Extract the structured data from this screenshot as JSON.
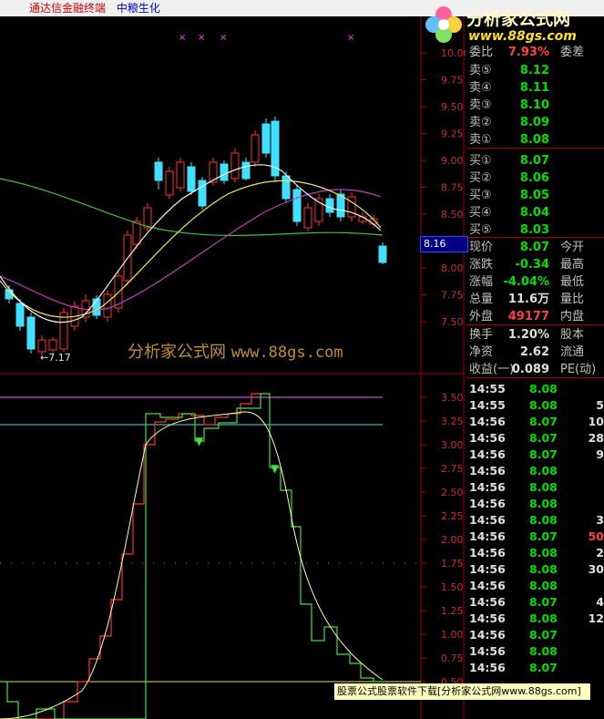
{
  "topbar": {
    "app_title": "通达信金融终端",
    "stock_name": "中粮生化"
  },
  "logo": {
    "name": "分析家公式网",
    "url": "www.88gs.com"
  },
  "watermark": {
    "text": "分析家公式网",
    "url": "www.88gs.com"
  },
  "main_chart": {
    "y_ticks": [
      "10.00",
      "9.75",
      "9.50",
      "9.25",
      "9.00",
      "8.75",
      "8.50",
      "8.25",
      "8.00",
      "7.75",
      "7.50"
    ],
    "low_marker": "7.17",
    "current_price_tag": "8.16"
  },
  "sub_chart": {
    "y_ticks": [
      "3.50",
      "3.25",
      "3.00",
      "2.75",
      "2.50",
      "2.25",
      "2.00",
      "1.75",
      "1.50",
      "1.25",
      "1.00",
      "0.75",
      "0.50"
    ]
  },
  "order_book": {
    "header_partial": {
      "label": "委比",
      "value": "7.93%",
      "label2": "委差"
    },
    "asks": [
      {
        "label": "卖⑤",
        "price": "8.12"
      },
      {
        "label": "卖④",
        "price": "8.11"
      },
      {
        "label": "卖③",
        "price": "8.10"
      },
      {
        "label": "卖②",
        "price": "8.09"
      },
      {
        "label": "卖①",
        "price": "8.08"
      }
    ],
    "bids": [
      {
        "label": "买①",
        "price": "8.07"
      },
      {
        "label": "买②",
        "price": "8.06"
      },
      {
        "label": "买③",
        "price": "8.05"
      },
      {
        "label": "买④",
        "price": "8.04"
      },
      {
        "label": "买⑤",
        "price": "8.03"
      }
    ]
  },
  "quote": [
    {
      "label": "现价",
      "value": "8.07",
      "label2": "今开",
      "color": "green"
    },
    {
      "label": "涨跌",
      "value": "-0.34",
      "label2": "最高",
      "color": "green"
    },
    {
      "label": "涨幅",
      "value": "-4.04%",
      "label2": "最低",
      "color": "green"
    },
    {
      "label": "总量",
      "value": "11.6万",
      "label2": "量比",
      "color": "white"
    },
    {
      "label": "外盘",
      "value": "49177",
      "label2": "内盘",
      "color": "red"
    },
    {
      "label": "换手",
      "value": "1.20%",
      "label2": "股本",
      "color": "white"
    },
    {
      "label": "净资",
      "value": "2.62",
      "label2": "流通",
      "color": "white"
    },
    {
      "label": "收益(一)",
      "value": "0.089",
      "label2": "PE(动)",
      "color": "white"
    }
  ],
  "ticks": [
    {
      "time": "14:55",
      "price": "8.08",
      "vol": "",
      "color": "green"
    },
    {
      "time": "14:55",
      "price": "8.08",
      "vol": "5",
      "color": "green"
    },
    {
      "time": "14:56",
      "price": "8.07",
      "vol": "10",
      "color": "green"
    },
    {
      "time": "14:56",
      "price": "8.07",
      "vol": "28",
      "color": "green"
    },
    {
      "time": "14:56",
      "price": "8.07",
      "vol": "9",
      "color": "green"
    },
    {
      "time": "14:56",
      "price": "8.08",
      "vol": "",
      "color": "green"
    },
    {
      "time": "14:56",
      "price": "8.08",
      "vol": "",
      "color": "green"
    },
    {
      "time": "14:56",
      "price": "8.08",
      "vol": "",
      "color": "green"
    },
    {
      "time": "14:56",
      "price": "8.08",
      "vol": "3",
      "color": "green"
    },
    {
      "time": "14:56",
      "price": "8.07",
      "vol": "50",
      "color": "green"
    },
    {
      "time": "14:56",
      "price": "8.08",
      "vol": "2",
      "color": "green"
    },
    {
      "time": "14:56",
      "price": "8.08",
      "vol": "30",
      "color": "green"
    },
    {
      "time": "14:56",
      "price": "8.08",
      "vol": "",
      "color": "green"
    },
    {
      "time": "14:56",
      "price": "8.07",
      "vol": "4",
      "color": "green"
    },
    {
      "time": "14:56",
      "price": "8.08",
      "vol": "12",
      "color": "green"
    },
    {
      "time": "14:56",
      "price": "8.07",
      "vol": "",
      "color": "green"
    },
    {
      "time": "14:56",
      "price": "8.08",
      "vol": "",
      "color": "green"
    },
    {
      "time": "14:56",
      "price": "8.07",
      "vol": "",
      "color": "green"
    }
  ],
  "ad_bar": {
    "text": "股票公式股票软件下载[分析家公式网www.88gs.com]"
  }
}
